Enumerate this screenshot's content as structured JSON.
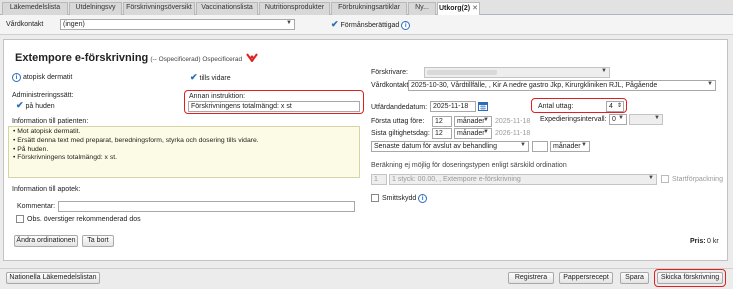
{
  "tabs": [
    {
      "label": "Läkemedelslista",
      "active": false
    },
    {
      "label": "Utdelningsvy",
      "active": false
    },
    {
      "label": "Förskrivningsöversikt",
      "active": false
    },
    {
      "label": "Vaccinationslista",
      "active": false
    },
    {
      "label": "Nutritionsprodukter",
      "active": false
    },
    {
      "label": "Förbrukningsartiklar",
      "active": false
    },
    {
      "label": "Ny...",
      "active": false
    },
    {
      "label": "Utkorg(2)",
      "active": true,
      "close": "✕"
    }
  ],
  "topbar": {
    "vardkontakt_label": "Vårdkontakt",
    "vardkontakt_value": "(ingen)",
    "formansberattigad_label": "Förmånsberättigad"
  },
  "form": {
    "title": "Extempore e-förskrivning",
    "subtitle": "(-- Ospecificerad) Ospecificerad",
    "atopisk_label": "atopisk dermatit",
    "tills_vidare_label": "tills vidare",
    "admin_label": "Administreringssätt:",
    "admin_value": "på huden",
    "annan_label": "Annan instruktion:",
    "annan_value": "Förskrivningens totalmängd: x st",
    "patient_info_label": "Information till patienten:",
    "patient_info_lines": [
      "• Mot atopisk dermatit.",
      "• Ersätt denna text med preparat, beredningsform, styrka och dosering tills vidare.",
      "• På huden.",
      "• Förskrivningens totalmängd: x st."
    ],
    "apotek_label": "Information till apotek:",
    "kommentar_label": "Kommentar:",
    "obs_label": "Obs. överstiger rekommenderad dos",
    "andra_btn": "Ändra ordinationen",
    "tabort_btn": "Ta bort",
    "forskrivare_label": "Förskrivare:",
    "vardkontakt_label": "Vårdkontakt:",
    "vardkontakt_value": "2025-10-30, Vårdtillfälle, , Kir A nedre gastro Jkp, Kirurgkliniken RJL, Pågående",
    "utfardande_label": "Utfärdandedatum:",
    "utfardande_value": "2025-11-18",
    "antal_label": "Antal uttag:",
    "antal_value": "4",
    "forsta_label": "Första uttag före:",
    "forsta_num": "12",
    "forsta_unit": "månader",
    "forsta_date": "2025-11-18",
    "exped_label": "Expedieringsintervall:",
    "exped_value": "0",
    "sista_label": "Sista giltighetsdag:",
    "sista_num": "12",
    "sista_unit": "månader",
    "sista_date": "2026-11-18",
    "senaste_value": "Senaste datum för avslut av behandling",
    "senaste_unit": "månader",
    "berakning_label": "Beräkning ej möjlig för doseringstypen enligt särskild ordination",
    "berakning_num": "1",
    "berakning_value": "1 styck: 00.00, , Extempore e-förskrivning",
    "startforpackning_label": "Startförpackning",
    "smittskydd_label": "Smittskydd",
    "pris_label": "Pris:",
    "pris_value": "0 kr"
  },
  "bottom": {
    "nationella": "Nationella Läkemedelslistan",
    "registrera": "Registrera",
    "pappersrecept": "Pappersrecept",
    "spara": "Spara",
    "skicka": "Skicka förskrivning"
  },
  "colors": {
    "accent": "#2a6ebb",
    "highlight": "#e02020",
    "note_bg": "#fbfbe6"
  }
}
